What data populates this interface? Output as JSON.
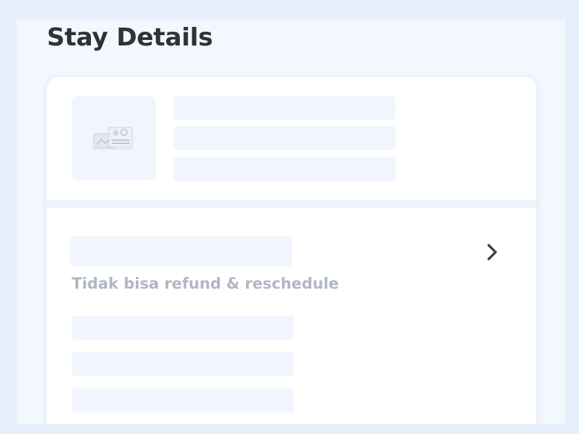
{
  "page": {
    "title": "Stay Details"
  },
  "stay_card": {
    "image_icon": "hotel-placeholder-illustration",
    "policy_text": "Tidak bisa refund & reschedule",
    "chevron_icon": "chevron-right-icon"
  },
  "colors": {
    "skeleton": "#f1f6fe",
    "title_text": "#2f3238",
    "policy_text": "#b1b8c4",
    "background": "#e6f0fc"
  }
}
